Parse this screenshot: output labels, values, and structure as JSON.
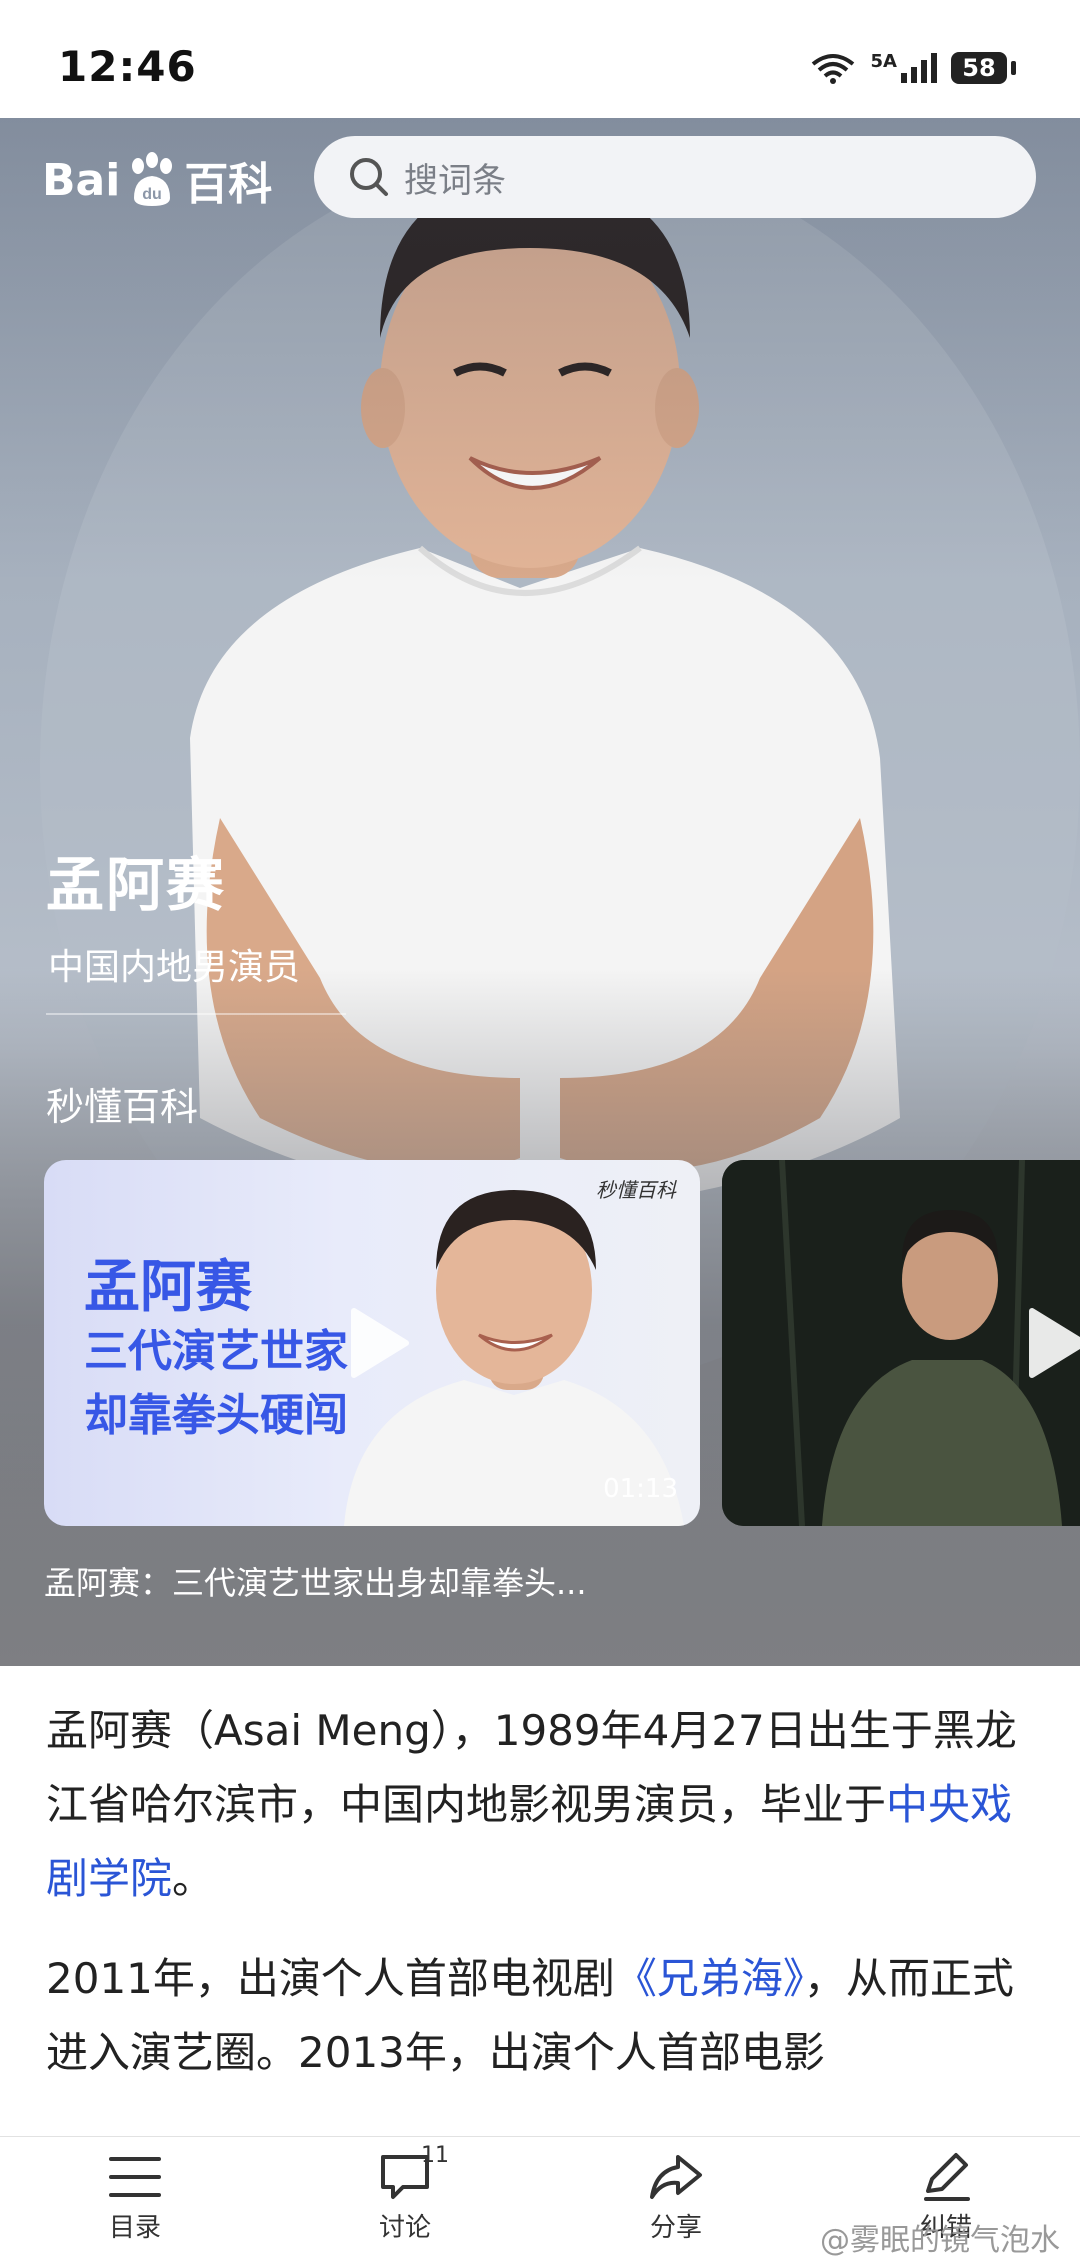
{
  "status_bar": {
    "time": "12:46",
    "battery": "58",
    "signal_label": "5A"
  },
  "header": {
    "logo_text": "Baidu百科",
    "logo_bai": "Bai",
    "logo_du": "du",
    "logo_baike": "百科",
    "search_placeholder": "搜词条"
  },
  "hero": {
    "name": "孟阿赛",
    "subtitle": "中国内地男演员",
    "section_label": "秒懂百科"
  },
  "videos": [
    {
      "overlay_lines": [
        "孟阿赛",
        "三代演艺世家",
        "却靠拳头硬闯"
      ],
      "brand": "秒懂百科",
      "duration": "01:13",
      "caption": "孟阿赛：三代演艺世家出身却靠拳头..."
    },
    {
      "caption": ""
    }
  ],
  "article": {
    "p1_pre": "孟阿赛（Asai Meng），1989年4月27日出生于黑龙江省哈尔滨市，中国内地影视男演员，毕业于",
    "p1_link": "中央戏剧学院",
    "p1_post": "。",
    "p2_pre": "2011年，出演个人首部电视剧",
    "p2_link": "《兄弟海》",
    "p2_post": "，从而正式进入演艺圈。2013年，出演个人首部电影"
  },
  "bottom_bar": {
    "tabs": [
      {
        "label": "目录",
        "icon": "menu-list-icon"
      },
      {
        "label": "讨论",
        "icon": "comment-icon",
        "badge": "11"
      },
      {
        "label": "分享",
        "icon": "share-icon"
      },
      {
        "label": "纠错",
        "icon": "edit-pen-icon"
      }
    ],
    "watermark": "@雾眠的镜气泡水"
  }
}
